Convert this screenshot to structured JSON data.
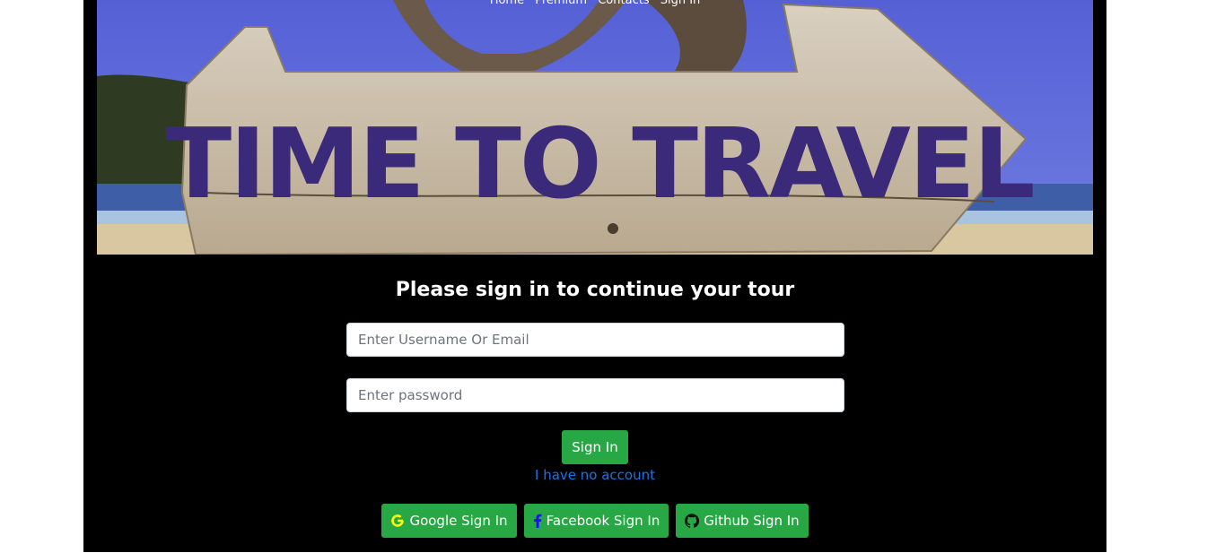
{
  "nav": {
    "items": [
      "Home",
      "Premium",
      "Contacts",
      "Sign In"
    ]
  },
  "hero": {
    "sign_text": "TIME TO TRAVEL"
  },
  "form": {
    "heading": "Please sign in to continue your tour",
    "username_placeholder": "Enter Username Or Email",
    "password_placeholder": "Enter password",
    "submit_label": "Sign In",
    "register_link": "I have no account"
  },
  "social": {
    "google_label": "Google Sign In",
    "facebook_label": "Facebook Sign In",
    "github_label": "Github Sign In"
  },
  "colors": {
    "page_background": "#ffffff",
    "frame_background": "#000000",
    "button_green": "#28a745",
    "link_blue": "#1a73e8",
    "google_icon": "#ffff00",
    "facebook_icon": "#1a0dff"
  },
  "icons": {
    "google": "google-icon",
    "facebook": "facebook-icon",
    "github": "github-icon"
  }
}
